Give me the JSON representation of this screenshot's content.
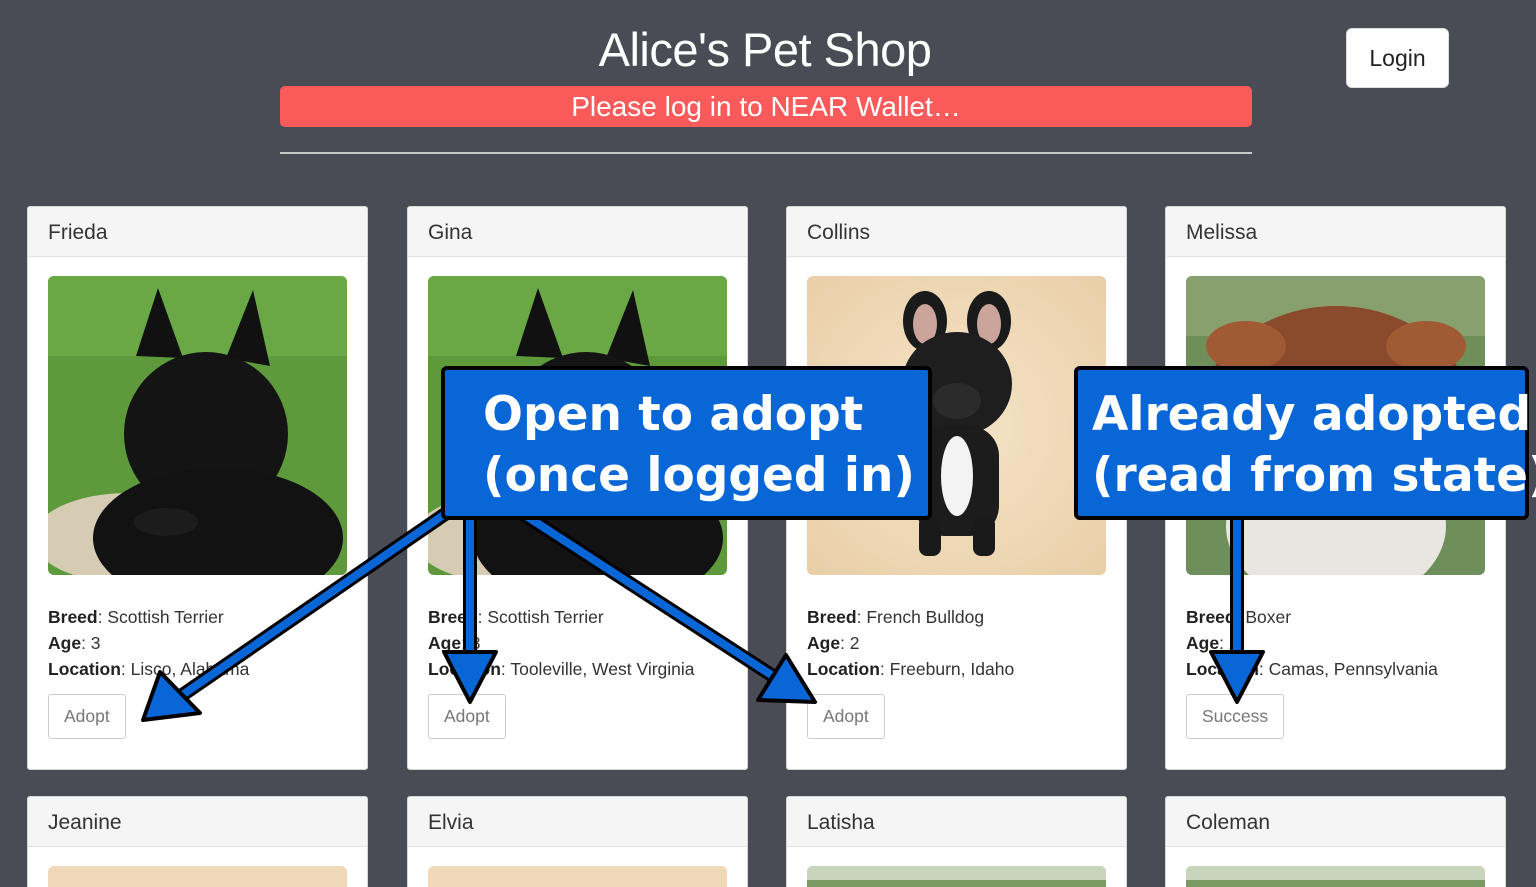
{
  "header": {
    "title": "Alice's Pet Shop",
    "login_label": "Login",
    "alert_text": "Please log in to NEAR Wallet…"
  },
  "labels": {
    "breed": "Breed",
    "age": "Age",
    "location": "Location"
  },
  "pets": [
    {
      "name": "Frieda",
      "breed": "Scottish Terrier",
      "age": "3",
      "location": "Lisco, Alabama",
      "action": "Adopt",
      "photo": "scottish-terrier-photo"
    },
    {
      "name": "Gina",
      "breed": "Scottish Terrier",
      "age": "3",
      "location": "Tooleville, West Virginia",
      "action": "Adopt",
      "photo": "scottish-terrier-photo"
    },
    {
      "name": "Collins",
      "breed": "French Bulldog",
      "age": "2",
      "location": "Freeburn, Idaho",
      "action": "Adopt",
      "photo": "french-bulldog-photo"
    },
    {
      "name": "Melissa",
      "breed": "Boxer",
      "age": "2",
      "location": "Camas, Pennsylvania",
      "action": "Success",
      "photo": "boxer-photo"
    },
    {
      "name": "Jeanine"
    },
    {
      "name": "Elvia"
    },
    {
      "name": "Latisha"
    },
    {
      "name": "Coleman"
    }
  ],
  "annotations": {
    "open": {
      "line1": "Open to adopt",
      "line2": "(once logged in)"
    },
    "adopted": {
      "line1": "Already adopted",
      "line2": "(read from state)"
    }
  },
  "colors": {
    "background": "#494c54",
    "alert": "#fa5a5a",
    "callout": "#0866d6"
  }
}
